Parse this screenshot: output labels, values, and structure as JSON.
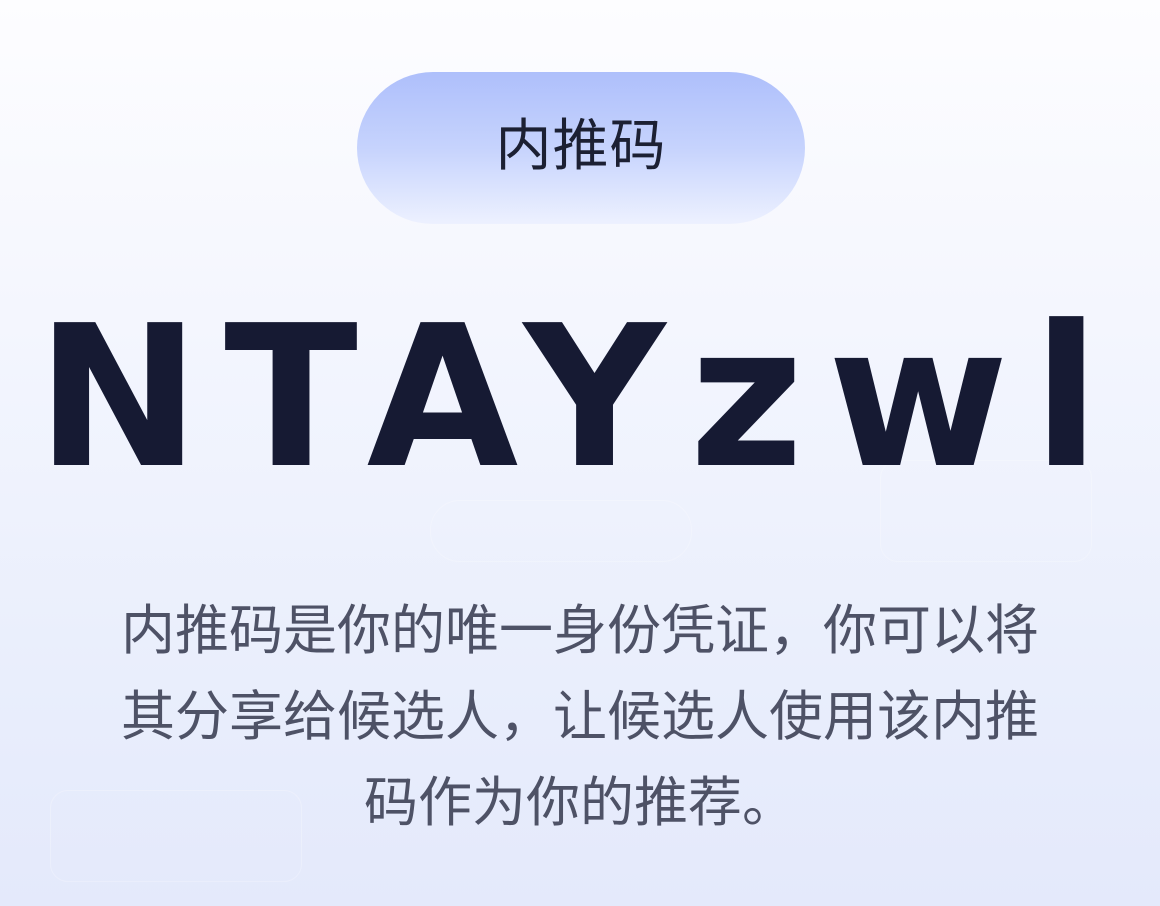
{
  "badge": {
    "label": "内推码"
  },
  "referral": {
    "code": "NTAYzwl",
    "description": "内推码是你的唯一身份凭证，你可以将其分享给候选人，让候选人使用该内推码作为你的推荐。"
  },
  "colors": {
    "text_primary": "#161a33",
    "text_secondary": "#4e5266",
    "badge_gradient_top": "#aebffb",
    "badge_gradient_bottom": "#edf1ff",
    "background": "#f4f6fe"
  }
}
